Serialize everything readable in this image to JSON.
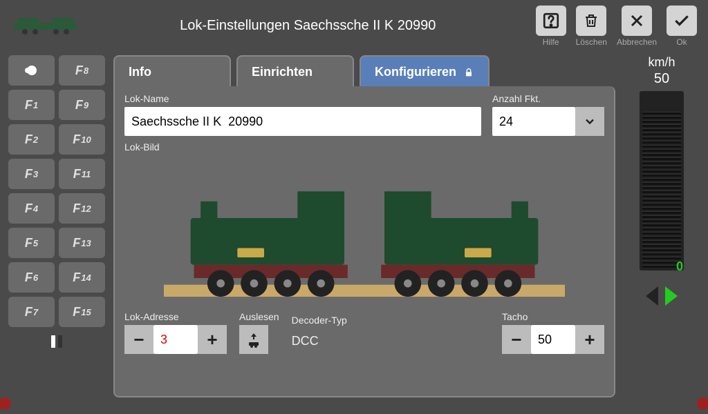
{
  "header": {
    "title": "Lok-Einstellungen Saechssche II K  20990",
    "buttons": {
      "help": "Hilfe",
      "delete": "Löschen",
      "cancel": "Abbrechen",
      "ok": "Ok"
    }
  },
  "functions": {
    "left": [
      "",
      "F1",
      "F2",
      "F3",
      "F4",
      "F5",
      "F6",
      "F7"
    ],
    "right": [
      "F8",
      "F9",
      "F10",
      "F11",
      "F12",
      "F13",
      "F14",
      "F15"
    ]
  },
  "tabs": {
    "info": "Info",
    "setup": "Einrichten",
    "config": "Konfigurieren"
  },
  "form": {
    "lokname_label": "Lok-Name",
    "lokname_value": "Saechssche II K  20990",
    "fktcount_label": "Anzahl Fkt.",
    "fktcount_value": "24",
    "lokbild_label": "Lok-Bild",
    "address_label": "Lok-Adresse",
    "address_value": "3",
    "read_label": "Auslesen",
    "decoder_label": "Decoder-Typ",
    "decoder_value": "DCC",
    "tacho_label": "Tacho",
    "tacho_value": "50"
  },
  "speed": {
    "unit": "km/h",
    "value": "50",
    "zero": "0"
  }
}
